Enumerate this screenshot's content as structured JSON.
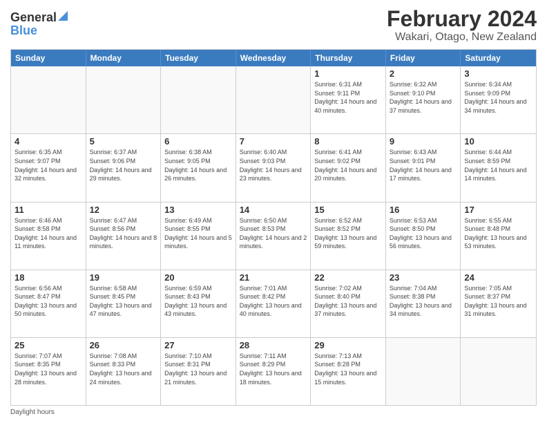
{
  "logo": {
    "general": "General",
    "blue": "Blue"
  },
  "header": {
    "month_year": "February 2024",
    "location": "Wakari, Otago, New Zealand"
  },
  "days_of_week": [
    "Sunday",
    "Monday",
    "Tuesday",
    "Wednesday",
    "Thursday",
    "Friday",
    "Saturday"
  ],
  "weeks": [
    [
      {
        "day": "",
        "empty": true
      },
      {
        "day": "",
        "empty": true
      },
      {
        "day": "",
        "empty": true
      },
      {
        "day": "",
        "empty": true
      },
      {
        "day": "1",
        "sunrise": "6:31 AM",
        "sunset": "9:11 PM",
        "daylight": "14 hours and 40 minutes."
      },
      {
        "day": "2",
        "sunrise": "6:32 AM",
        "sunset": "9:10 PM",
        "daylight": "14 hours and 37 minutes."
      },
      {
        "day": "3",
        "sunrise": "6:34 AM",
        "sunset": "9:09 PM",
        "daylight": "14 hours and 34 minutes."
      }
    ],
    [
      {
        "day": "4",
        "sunrise": "6:35 AM",
        "sunset": "9:07 PM",
        "daylight": "14 hours and 32 minutes."
      },
      {
        "day": "5",
        "sunrise": "6:37 AM",
        "sunset": "9:06 PM",
        "daylight": "14 hours and 29 minutes."
      },
      {
        "day": "6",
        "sunrise": "6:38 AM",
        "sunset": "9:05 PM",
        "daylight": "14 hours and 26 minutes."
      },
      {
        "day": "7",
        "sunrise": "6:40 AM",
        "sunset": "9:03 PM",
        "daylight": "14 hours and 23 minutes."
      },
      {
        "day": "8",
        "sunrise": "6:41 AM",
        "sunset": "9:02 PM",
        "daylight": "14 hours and 20 minutes."
      },
      {
        "day": "9",
        "sunrise": "6:43 AM",
        "sunset": "9:01 PM",
        "daylight": "14 hours and 17 minutes."
      },
      {
        "day": "10",
        "sunrise": "6:44 AM",
        "sunset": "8:59 PM",
        "daylight": "14 hours and 14 minutes."
      }
    ],
    [
      {
        "day": "11",
        "sunrise": "6:46 AM",
        "sunset": "8:58 PM",
        "daylight": "14 hours and 11 minutes."
      },
      {
        "day": "12",
        "sunrise": "6:47 AM",
        "sunset": "8:56 PM",
        "daylight": "14 hours and 8 minutes."
      },
      {
        "day": "13",
        "sunrise": "6:49 AM",
        "sunset": "8:55 PM",
        "daylight": "14 hours and 5 minutes."
      },
      {
        "day": "14",
        "sunrise": "6:50 AM",
        "sunset": "8:53 PM",
        "daylight": "14 hours and 2 minutes."
      },
      {
        "day": "15",
        "sunrise": "6:52 AM",
        "sunset": "8:52 PM",
        "daylight": "13 hours and 59 minutes."
      },
      {
        "day": "16",
        "sunrise": "6:53 AM",
        "sunset": "8:50 PM",
        "daylight": "13 hours and 56 minutes."
      },
      {
        "day": "17",
        "sunrise": "6:55 AM",
        "sunset": "8:48 PM",
        "daylight": "13 hours and 53 minutes."
      }
    ],
    [
      {
        "day": "18",
        "sunrise": "6:56 AM",
        "sunset": "8:47 PM",
        "daylight": "13 hours and 50 minutes."
      },
      {
        "day": "19",
        "sunrise": "6:58 AM",
        "sunset": "8:45 PM",
        "daylight": "13 hours and 47 minutes."
      },
      {
        "day": "20",
        "sunrise": "6:59 AM",
        "sunset": "8:43 PM",
        "daylight": "13 hours and 43 minutes."
      },
      {
        "day": "21",
        "sunrise": "7:01 AM",
        "sunset": "8:42 PM",
        "daylight": "13 hours and 40 minutes."
      },
      {
        "day": "22",
        "sunrise": "7:02 AM",
        "sunset": "8:40 PM",
        "daylight": "13 hours and 37 minutes."
      },
      {
        "day": "23",
        "sunrise": "7:04 AM",
        "sunset": "8:38 PM",
        "daylight": "13 hours and 34 minutes."
      },
      {
        "day": "24",
        "sunrise": "7:05 AM",
        "sunset": "8:37 PM",
        "daylight": "13 hours and 31 minutes."
      }
    ],
    [
      {
        "day": "25",
        "sunrise": "7:07 AM",
        "sunset": "8:35 PM",
        "daylight": "13 hours and 28 minutes."
      },
      {
        "day": "26",
        "sunrise": "7:08 AM",
        "sunset": "8:33 PM",
        "daylight": "13 hours and 24 minutes."
      },
      {
        "day": "27",
        "sunrise": "7:10 AM",
        "sunset": "8:31 PM",
        "daylight": "13 hours and 21 minutes."
      },
      {
        "day": "28",
        "sunrise": "7:11 AM",
        "sunset": "8:29 PM",
        "daylight": "13 hours and 18 minutes."
      },
      {
        "day": "29",
        "sunrise": "7:13 AM",
        "sunset": "8:28 PM",
        "daylight": "13 hours and 15 minutes."
      },
      {
        "day": "",
        "empty": true
      },
      {
        "day": "",
        "empty": true
      }
    ]
  ],
  "footer": {
    "label": "Daylight hours"
  }
}
